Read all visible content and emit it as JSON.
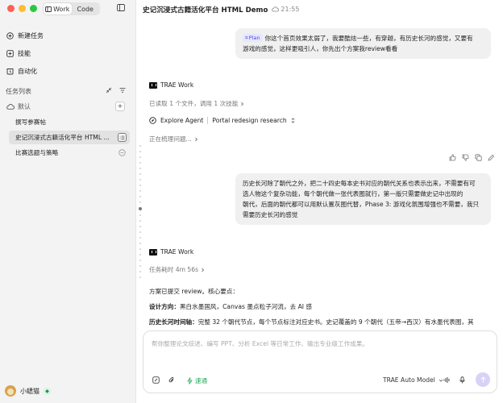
{
  "sidebar": {
    "tabs": [
      {
        "label": "Work"
      },
      {
        "label": "Code"
      }
    ],
    "nav": [
      {
        "label": "新建任务",
        "icon": "plus-circle-icon"
      },
      {
        "label": "技能",
        "icon": "skills-icon"
      },
      {
        "label": "自动化",
        "icon": "clock-icon"
      }
    ],
    "section_label": "任务列表",
    "group": {
      "label": "默认"
    },
    "tasks": [
      {
        "label": "撰写参赛帖"
      },
      {
        "label": "史记沉浸式古籍活化平台 HTML ..."
      },
      {
        "label": "比赛选题与策略"
      }
    ],
    "user": {
      "name": "小蟋猫"
    }
  },
  "header": {
    "title": "史记沉浸式古籍活化平台 HTML Demo",
    "time": "21:55"
  },
  "conversation": {
    "user1": {
      "tag": "Plan",
      "text1": "你这个首页效果太弱了，我要酷炫一些，有穿越，有历史长河的感觉，又要有",
      "text2": "游戏的感觉，这样更吸引人，你先出个方案我review看看"
    },
    "agent_name": "TRAE Work",
    "read_status": "已读取 1 个文件，调用 1 次技能",
    "explore_agent": "Explore Agent",
    "explore_task": "Portal redesign research",
    "thinking": "正在梳理问题...",
    "user2": {
      "lines": [
        "历史长河除了朝代之外，把二十四史每本史书对应的朝代关系也表示出来，不需要有可",
        "选人物这个复杂功能，每个朝代做一张代表图就行，第一版只需要做史记中出现的",
        "朝代，后面的朝代都可以用默认置灰图代替，Phase 3: 游戏化氛围增强也不需要，我只",
        "需要历史长河的感觉"
      ]
    },
    "agent_name2": "TRAE Work",
    "duration": "任务耗时 4m 56s",
    "answer": {
      "intro": "方案已提交 review。核心要点：",
      "design_label": "设计方向：",
      "design_text": "黑白水墨国风，Canvas 墨点粒子河流，去 AI 感",
      "timeline_label": "历史长河时间轴：",
      "timeline_text": "完整 32 个朝代节点，每个节点标注对应史书。史记覆盖的 9 个朝代（五帝→西汉）有水墨代表图，其"
    }
  },
  "composer": {
    "placeholder": "帮你整理论文综述、编写 PPT、分析 Excel 等日常工作、输出专业级工作成果。",
    "speed_label": "速通",
    "model_label": "TRAE Auto Model"
  }
}
